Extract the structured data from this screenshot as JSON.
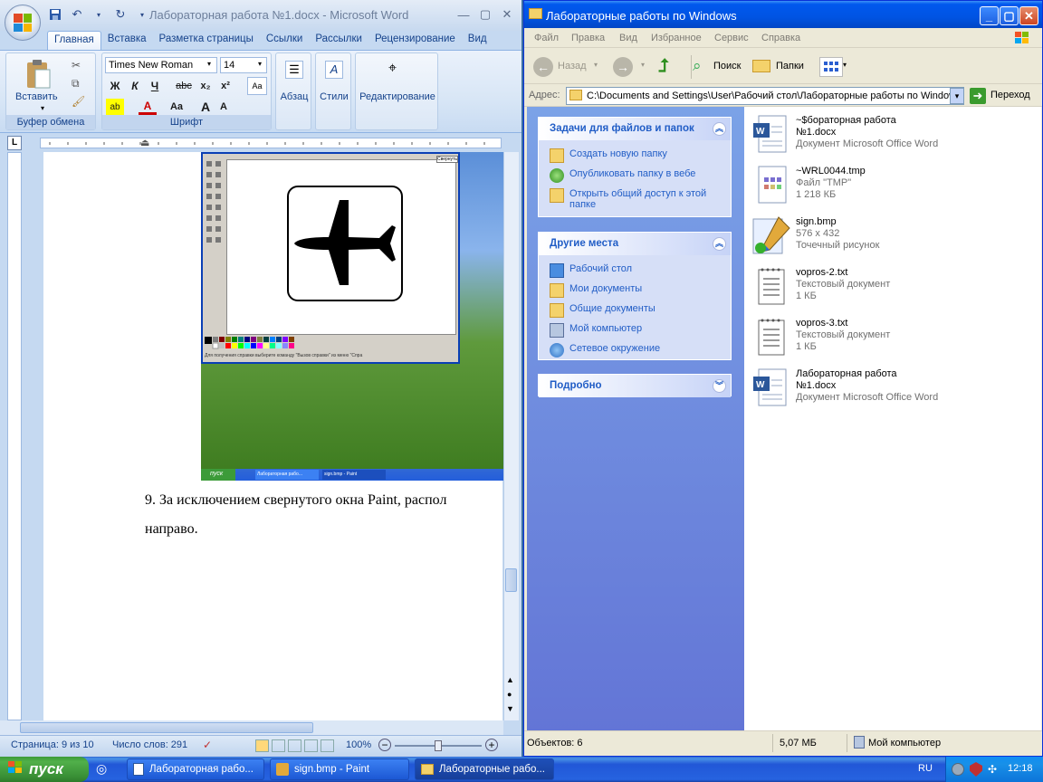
{
  "word": {
    "title": "Лабораторная работа №1.docx - Microsoft Word",
    "tabs": [
      "Главная",
      "Вставка",
      "Разметка страницы",
      "Ссылки",
      "Рассылки",
      "Рецензирование",
      "Вид"
    ],
    "active_tab": "Главная",
    "clipboard": {
      "paste_label": "Вставить",
      "group_label": "Буфер обмена"
    },
    "font": {
      "name": "Times New Roman",
      "size": "14",
      "group_label": "Шрифт",
      "bold": "Ж",
      "italic": "К",
      "underline": "Ч",
      "strike": "abc",
      "sub": "x₂",
      "sup": "x²",
      "case": "Aa",
      "grow": "A",
      "shrink": "A"
    },
    "groups": {
      "paragraph": "Абзац",
      "styles": "Стили",
      "editing": "Редактирование"
    },
    "doc_text_line1": "9. За исключением свернутого окна Paint, распол",
    "doc_text_line2": "направо.",
    "status": {
      "page": "Страница: 9 из 10",
      "words": "Число слов: 291",
      "zoom": "100%"
    }
  },
  "embedded_screenshot": {
    "paint_status": "Для получения справки выберите команду \"Вызов справки\" из меню \"Спра",
    "taskbar_start": "пуск",
    "task1": "Лабораторная рабо...",
    "task2": "sign.bmp - Paint",
    "restore_btn": "Свернуть"
  },
  "explorer": {
    "title": "Лабораторные работы по Windows",
    "menu": [
      "Файл",
      "Правка",
      "Вид",
      "Избранное",
      "Сервис",
      "Справка"
    ],
    "toolbar": {
      "back": "Назад",
      "search": "Поиск",
      "folders": "Папки"
    },
    "address_label": "Адрес:",
    "address": "C:\\Documents and Settings\\User\\Рабочий стол\\Лабораторные работы по Windows",
    "go": "Переход",
    "tasks_header": "Задачи для файлов и папок",
    "tasks": [
      "Создать новую папку",
      "Опубликовать папку в вебе",
      "Открыть общий доступ к этой папке"
    ],
    "places_header": "Другие места",
    "places": [
      "Рабочий стол",
      "Мои документы",
      "Общие документы",
      "Мой компьютер",
      "Сетевое окружение"
    ],
    "details_header": "Подробно",
    "files": [
      {
        "name1": "~$бораторная работа",
        "name2": "№1.docx",
        "sub1": "Документ Microsoft Office Word",
        "sub2": ""
      },
      {
        "name1": "~WRL0044.tmp",
        "name2": "",
        "sub1": "Файл \"TMP\"",
        "sub2": "1 218 КБ"
      },
      {
        "name1": "sign.bmp",
        "name2": "",
        "sub1": "576 x 432",
        "sub2": "Точечный рисунок"
      },
      {
        "name1": "vopros-2.txt",
        "name2": "",
        "sub1": "Текстовый документ",
        "sub2": "1 КБ"
      },
      {
        "name1": "vopros-3.txt",
        "name2": "",
        "sub1": "Текстовый документ",
        "sub2": "1 КБ"
      },
      {
        "name1": "Лабораторная работа",
        "name2": "№1.docx",
        "sub1": "Документ Microsoft Office Word",
        "sub2": ""
      }
    ],
    "status": {
      "objects": "Объектов: 6",
      "size": "5,07 МБ",
      "location": "Мой компьютер"
    }
  },
  "taskbar": {
    "start": "пуск",
    "tasks": [
      "Лабораторная рабо...",
      "sign.bmp - Paint",
      "Лабораторные рабо..."
    ],
    "lang": "RU",
    "clock": "12:18"
  }
}
